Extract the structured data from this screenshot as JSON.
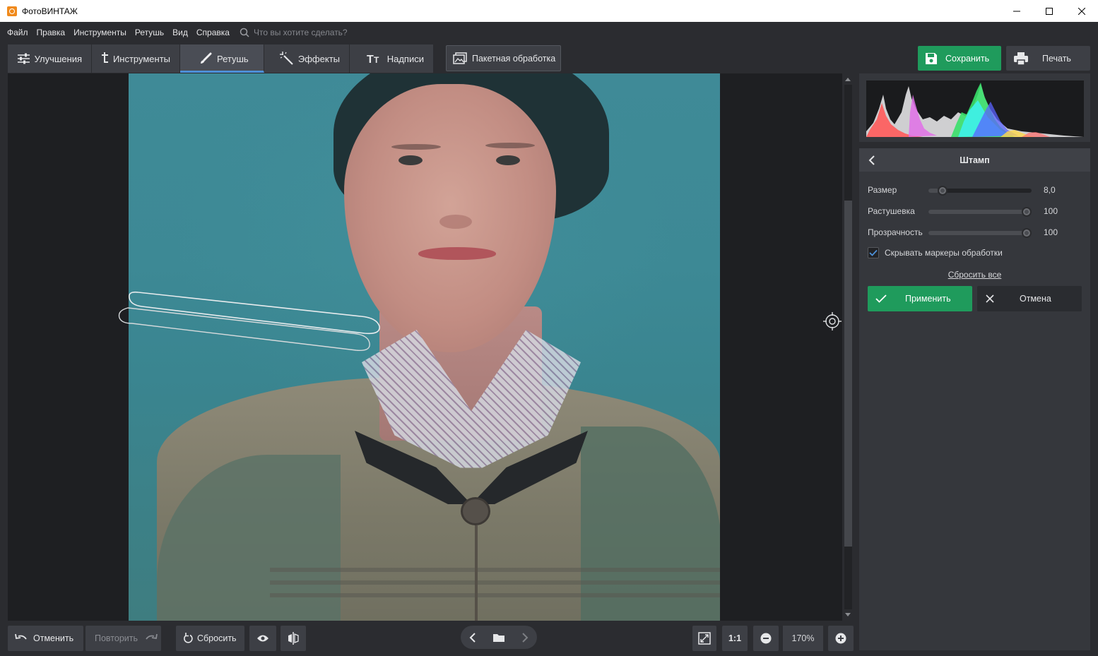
{
  "window": {
    "title": "ФотоВИНТАЖ",
    "controls": {
      "minimize": "—",
      "maximize": "☐",
      "close": "✕"
    }
  },
  "menu": {
    "items": [
      "Файл",
      "Правка",
      "Инструменты",
      "Ретушь",
      "Вид",
      "Справка"
    ],
    "search_placeholder": "Что вы хотите сделать?"
  },
  "toolbar": {
    "tabs": [
      {
        "label": "Улучшения",
        "icon": "sliders-icon",
        "active": false
      },
      {
        "label": "Инструменты",
        "icon": "crop-icon",
        "active": false
      },
      {
        "label": "Ретушь",
        "icon": "brush-icon",
        "active": true
      },
      {
        "label": "Эффекты",
        "icon": "magic-wand-icon",
        "active": false
      },
      {
        "label": "Надписи",
        "icon": "text-icon",
        "active": false
      }
    ],
    "batch_label": "Пакетная обработка",
    "save_label": "Сохранить",
    "print_label": "Печать",
    "accent_color": "#1f9b5c",
    "active_tab_color": "#4d90d8"
  },
  "stamp_panel": {
    "title": "Штамп",
    "sliders": [
      {
        "label": "Размер",
        "value": "8,0",
        "fraction": 0.1
      },
      {
        "label": "Растушевка",
        "value": "100",
        "fraction": 1.0
      },
      {
        "label": "Прозрачность",
        "value": "100",
        "fraction": 1.0
      }
    ],
    "hide_markers_label": "Скрывать маркеры обработки",
    "hide_markers_checked": true,
    "reset_all_label": "Сбросить все",
    "apply_label": "Применить",
    "cancel_label": "Отмена"
  },
  "bottombar": {
    "undo_label": "Отменить",
    "redo_label": "Повторить",
    "reset_label": "Сбросить",
    "one_to_one_label": "1:1",
    "zoom_label": "170%"
  }
}
